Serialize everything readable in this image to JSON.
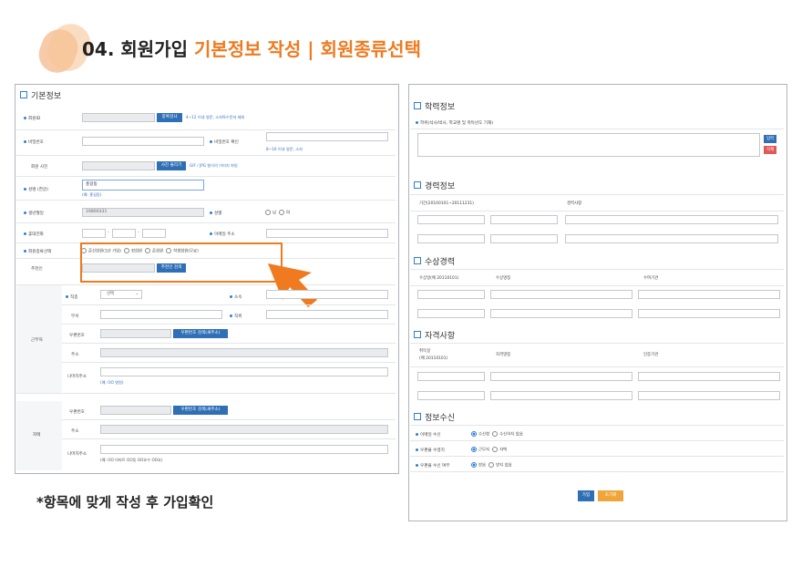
{
  "heading": {
    "prefix": "04.",
    "black": " 회원가입 ",
    "orange1": "기본정보 작성",
    "sep": " | ",
    "orange2": "회원종류선택"
  },
  "note": "*항목에 맞게 작성 후 가입확인",
  "colors": {
    "accent": "#ef7a1f",
    "primary": "#2f6fb6",
    "danger": "#e05a5a",
    "cta_secondary": "#f0a53a"
  },
  "left": {
    "title": "기본정보",
    "rows": {
      "id_label": "회원ID",
      "id_btn": "중복검사",
      "id_hint": "4~12 이내 영문, 소자특수문자 제외",
      "pw_label": "비밀번호",
      "pw_confirm_label": "비밀번호 확인",
      "pw_hint": "8~16 이내 영문, 소자",
      "photo_label": "회원 사진",
      "photo_btn": "사진 올리기",
      "photo_hint": "GIF / JPG 형식의 이미지 파일",
      "name_label": "성명 (한글)",
      "name_value": "홍길동",
      "name_example": "(예: 홍길동)",
      "birth_label": "생년월일",
      "birth_value": "19800331",
      "gender_label": "성별",
      "gender_options": [
        "남",
        "여"
      ],
      "mobile_label": "휴대전화",
      "email_label": "이메일 주소",
      "type_label": "회원종류선택",
      "type_options": [
        "준신회원(1년 가입)",
        "정회원",
        "준회원",
        "학생회원(무료)"
      ],
      "recommender_label": "추천인",
      "recommender_btn": "추천인 검색"
    },
    "work": {
      "group_label": "근무처",
      "job_label": "직종",
      "job_select": "선택",
      "affil_label": "소속",
      "dept_label": "부서",
      "position_label": "직위",
      "zip_label": "우편번호",
      "zip_btn": "우편번호 검색(새주소)",
      "addr_label": "주소",
      "detail_label": "나머지주소",
      "detail_example": "(예: OO 병원)"
    },
    "home": {
      "group_label": "자택",
      "zip_label": "우편번호",
      "zip_btn": "우편번호 검색(새주소)",
      "addr_label": "주소",
      "detail_label": "나머지주소",
      "detail_example": "(예: OO 아파트 OO동 OO호수 OO호)"
    }
  },
  "right": {
    "edu": {
      "title": "학력정보",
      "desc": "학위(석사/박사, 학교명 및 취득년도 기재)",
      "save": "입력",
      "delete": "삭제"
    },
    "career": {
      "title": "경력정보",
      "col1": "기간(20100101~20111231)",
      "col2": "경력사항"
    },
    "award": {
      "title": "수상경력",
      "col1": "수상일(예 20110101)",
      "col2": "수상명칭",
      "col3": "수여기관"
    },
    "license": {
      "title": "자격사항",
      "col1a": "취득일",
      "col1b": "(예 20110101)",
      "col2": "자격명칭",
      "col3": "인증기관"
    },
    "receive": {
      "title": "정보수신",
      "rows": [
        {
          "label": "이메일 수신",
          "opts": [
            "수신함",
            "수신하지 않음"
          ]
        },
        {
          "label": "우편물 수령지",
          "opts": [
            "근무지",
            "자택"
          ]
        },
        {
          "label": "우편물 수신 여부",
          "opts": [
            "받음",
            "받지 않음"
          ]
        }
      ]
    },
    "submit": "가입",
    "reset": "초기화"
  }
}
